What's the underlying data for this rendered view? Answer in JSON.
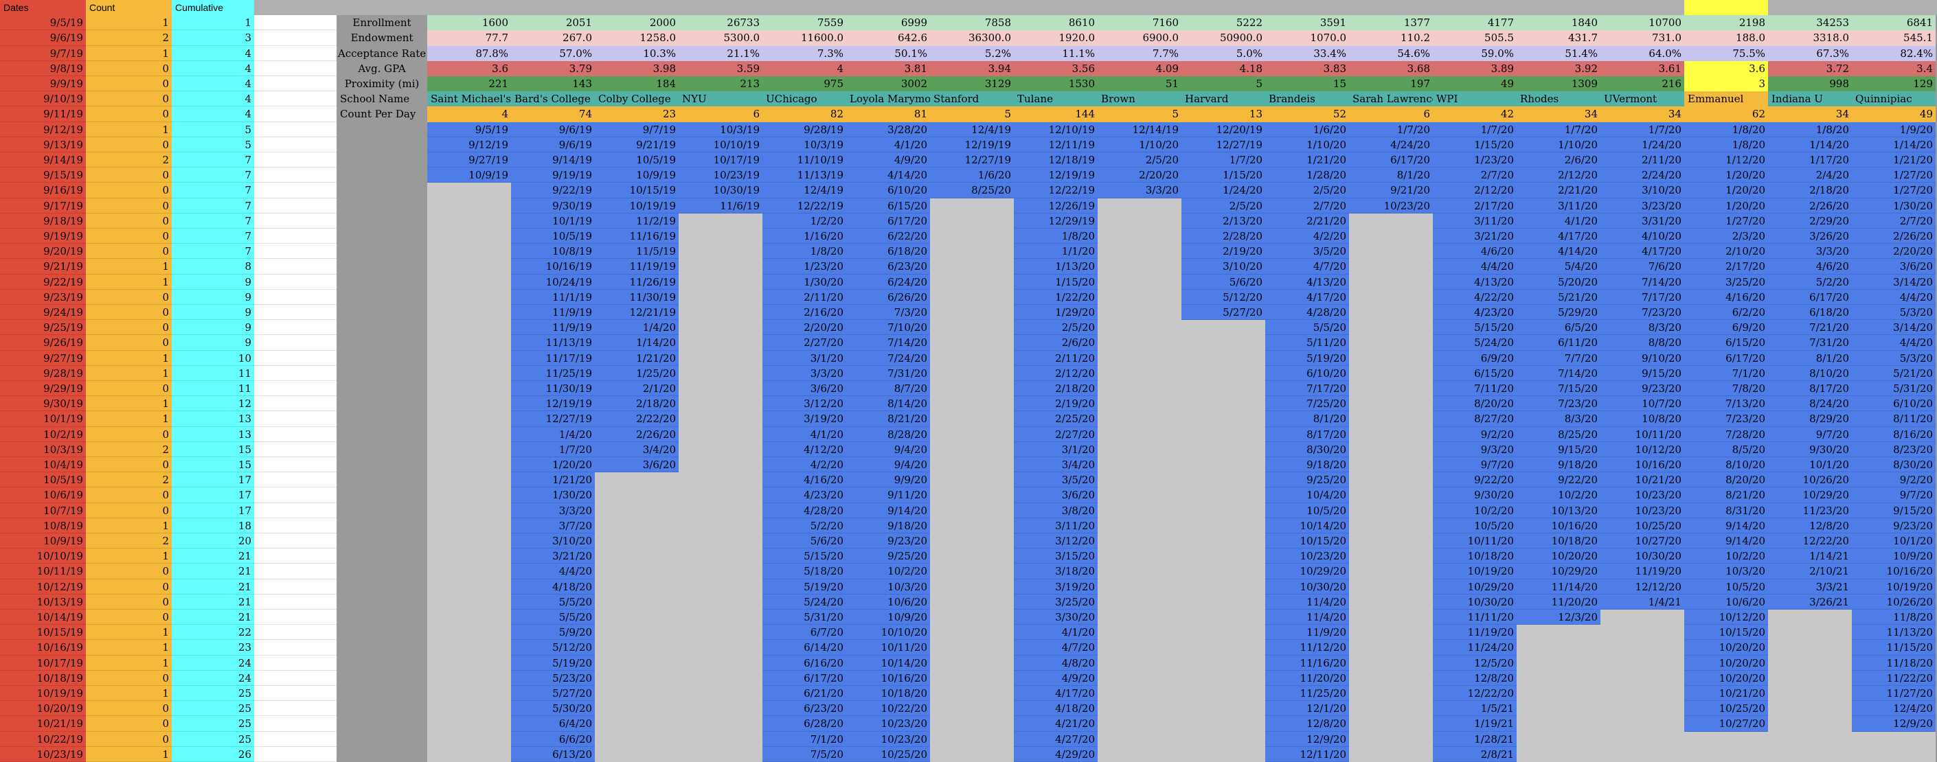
{
  "colors": {
    "dates": "#dd4b3a",
    "count": "#f5b93b",
    "cumulative": "#66ffff",
    "white": "#ffffff",
    "gray": "#9a9a9a",
    "lightgray": "#c8c8c8",
    "blue": "#4f7de8",
    "enroll": "#b7e1c1",
    "endow": "#f4cccc",
    "accept": "#c6c5f0",
    "gpa": "#d76f6f",
    "prox": "#5aa05a",
    "name": "#52b2a8",
    "countday": "#f5b93b",
    "yellow": "#ffff44",
    "topbar": "#b0b0b0"
  },
  "headers": {
    "dates": "Dates",
    "count": "Count",
    "cumulative": "Cumulative"
  },
  "left": {
    "dates": [
      "9/5/19",
      "9/6/19",
      "9/7/19",
      "9/8/19",
      "9/9/19",
      "9/10/19",
      "9/11/19",
      "9/12/19",
      "9/13/19",
      "9/14/19",
      "9/15/19",
      "9/16/19",
      "9/17/19",
      "9/18/19",
      "9/19/19",
      "9/20/19",
      "9/21/19",
      "9/22/19",
      "9/23/19",
      "9/24/19",
      "9/25/19",
      "9/26/19",
      "9/27/19",
      "9/28/19",
      "9/29/19",
      "9/30/19",
      "10/1/19",
      "10/2/19",
      "10/3/19",
      "10/4/19",
      "10/5/19",
      "10/6/19",
      "10/7/19",
      "10/8/19",
      "10/9/19",
      "10/10/19",
      "10/11/19",
      "10/12/19",
      "10/13/19",
      "10/14/19",
      "10/15/19",
      "10/16/19",
      "10/17/19",
      "10/18/19",
      "10/19/19",
      "10/20/19",
      "10/21/19",
      "10/22/19",
      "10/23/19"
    ],
    "counts": [
      "1",
      "2",
      "1",
      "0",
      "0",
      "0",
      "0",
      "1",
      "0",
      "2",
      "0",
      "0",
      "0",
      "0",
      "0",
      "0",
      "1",
      "1",
      "0",
      "0",
      "0",
      "0",
      "1",
      "1",
      "0",
      "1",
      "1",
      "0",
      "2",
      "0",
      "2",
      "0",
      "0",
      "1",
      "2",
      "1",
      "0",
      "0",
      "0",
      "0",
      "1",
      "1",
      "1",
      "0",
      "1",
      "0",
      "0",
      "0",
      "1"
    ],
    "cumulative": [
      "1",
      "3",
      "4",
      "4",
      "4",
      "4",
      "4",
      "5",
      "5",
      "7",
      "7",
      "7",
      "7",
      "7",
      "7",
      "7",
      "8",
      "9",
      "9",
      "9",
      "9",
      "9",
      "10",
      "11",
      "11",
      "12",
      "13",
      "13",
      "15",
      "15",
      "17",
      "17",
      "17",
      "18",
      "20",
      "21",
      "21",
      "21",
      "21",
      "21",
      "22",
      "23",
      "24",
      "24",
      "25",
      "25",
      "25",
      "25",
      "26"
    ]
  },
  "row_labels": [
    "Enrollment",
    "Endowment",
    "Acceptance Rate",
    "Avg. GPA",
    "Proximity (mi)",
    "School Name",
    "Count Per Day"
  ],
  "schools": [
    {
      "name": "Saint Michael's",
      "enrollment": "1600",
      "endowment": "77.7",
      "acceptance": "87.8%",
      "gpa": "3.6",
      "proximity": "221",
      "count": "4",
      "dates": [
        "9/5/19",
        "9/12/19",
        "9/27/19",
        "10/9/19"
      ]
    },
    {
      "name": "Bard's College",
      "enrollment": "2051",
      "endowment": "267.0",
      "acceptance": "57.0%",
      "gpa": "3.79",
      "proximity": "143",
      "count": "74",
      "dates": [
        "9/6/19",
        "9/6/19",
        "9/14/19",
        "9/19/19",
        "9/22/19",
        "9/30/19",
        "10/1/19",
        "10/5/19",
        "10/8/19",
        "10/16/19",
        "10/24/19",
        "11/1/19",
        "11/9/19",
        "11/9/19",
        "11/13/19",
        "11/17/19",
        "11/25/19",
        "11/30/19",
        "12/19/19",
        "12/27/19",
        "1/4/20",
        "1/7/20",
        "1/20/20",
        "1/21/20",
        "1/30/20",
        "3/3/20",
        "3/7/20",
        "3/10/20",
        "3/21/20",
        "4/4/20",
        "4/18/20",
        "5/5/20",
        "5/5/20",
        "5/9/20",
        "5/12/20",
        "5/19/20",
        "5/23/20",
        "5/27/20",
        "5/30/20",
        "6/4/20",
        "6/6/20",
        "6/13/20"
      ]
    },
    {
      "name": "Colby College",
      "enrollment": "2000",
      "endowment": "1258.0",
      "acceptance": "10.3%",
      "gpa": "3.98",
      "proximity": "184",
      "count": "23",
      "dates": [
        "9/7/19",
        "9/21/19",
        "10/5/19",
        "10/9/19",
        "10/15/19",
        "10/19/19",
        "11/2/19",
        "11/16/19",
        "11/5/19",
        "11/19/19",
        "11/26/19",
        "11/30/19",
        "12/21/19",
        "1/4/20",
        "1/14/20",
        "1/21/20",
        "1/25/20",
        "2/1/20",
        "2/18/20",
        "2/22/20",
        "2/26/20",
        "3/4/20",
        "3/6/20"
      ]
    },
    {
      "name": "NYU",
      "enrollment": "26733",
      "endowment": "5300.0",
      "acceptance": "21.1%",
      "gpa": "3.59",
      "proximity": "213",
      "count": "6",
      "dates": [
        "10/3/19",
        "10/10/19",
        "10/17/19",
        "10/23/19",
        "10/30/19",
        "11/6/19"
      ]
    },
    {
      "name": "UChicago",
      "enrollment": "7559",
      "endowment": "11600.0",
      "acceptance": "7.3%",
      "gpa": "4",
      "proximity": "975",
      "count": "82",
      "dates": [
        "9/28/19",
        "10/3/19",
        "11/10/19",
        "11/13/19",
        "12/4/19",
        "12/22/19",
        "1/2/20",
        "1/16/20",
        "1/8/20",
        "1/23/20",
        "1/30/20",
        "2/11/20",
        "2/16/20",
        "2/20/20",
        "2/27/20",
        "3/1/20",
        "3/3/20",
        "3/6/20",
        "3/12/20",
        "3/19/20",
        "4/1/20",
        "4/12/20",
        "4/2/20",
        "4/16/20",
        "4/23/20",
        "4/28/20",
        "5/2/20",
        "5/6/20",
        "5/15/20",
        "5/18/20",
        "5/19/20",
        "5/24/20",
        "5/31/20",
        "6/7/20",
        "6/14/20",
        "6/16/20",
        "6/17/20",
        "6/21/20",
        "6/23/20",
        "6/28/20",
        "7/1/20",
        "7/5/20"
      ]
    },
    {
      "name": "Loyola Marymount",
      "enrollment": "6999",
      "endowment": "642.6",
      "acceptance": "50.1%",
      "gpa": "3.81",
      "proximity": "3002",
      "count": "81",
      "dates": [
        "3/28/20",
        "4/1/20",
        "4/9/20",
        "4/14/20",
        "6/10/20",
        "6/15/20",
        "6/17/20",
        "6/22/20",
        "6/18/20",
        "6/23/20",
        "6/24/20",
        "6/26/20",
        "7/3/20",
        "7/10/20",
        "7/14/20",
        "7/24/20",
        "7/31/20",
        "8/7/20",
        "8/14/20",
        "8/21/20",
        "8/28/20",
        "9/4/20",
        "9/4/20",
        "9/9/20",
        "9/11/20",
        "9/14/20",
        "9/18/20",
        "9/23/20",
        "9/25/20",
        "10/2/20",
        "10/3/20",
        "10/6/20",
        "10/9/20",
        "10/10/20",
        "10/11/20",
        "10/14/20",
        "10/16/20",
        "10/18/20",
        "10/22/20",
        "10/23/20",
        "10/23/20",
        "10/25/20"
      ]
    },
    {
      "name": "Stanford",
      "enrollment": "7858",
      "endowment": "36300.0",
      "acceptance": "5.2%",
      "gpa": "3.94",
      "proximity": "3129",
      "count": "5",
      "dates": [
        "12/4/19",
        "12/19/19",
        "12/27/19",
        "1/6/20",
        "8/25/20"
      ]
    },
    {
      "name": "Tulane",
      "enrollment": "8610",
      "endowment": "1920.0",
      "acceptance": "11.1%",
      "gpa": "3.56",
      "proximity": "1530",
      "count": "144",
      "dates": [
        "12/10/19",
        "12/11/19",
        "12/18/19",
        "12/19/19",
        "12/22/19",
        "12/26/19",
        "12/29/19",
        "1/8/20",
        "1/1/20",
        "1/13/20",
        "1/15/20",
        "1/22/20",
        "1/29/20",
        "2/5/20",
        "2/6/20",
        "2/11/20",
        "2/12/20",
        "2/18/20",
        "2/19/20",
        "2/25/20",
        "2/27/20",
        "3/1/20",
        "3/4/20",
        "3/5/20",
        "3/6/20",
        "3/8/20",
        "3/11/20",
        "3/12/20",
        "3/15/20",
        "3/18/20",
        "3/19/20",
        "3/25/20",
        "3/30/20",
        "4/1/20",
        "4/7/20",
        "4/8/20",
        "4/9/20",
        "4/17/20",
        "4/18/20",
        "4/21/20",
        "4/27/20",
        "4/29/20"
      ]
    },
    {
      "name": "Brown",
      "enrollment": "7160",
      "endowment": "6900.0",
      "acceptance": "7.7%",
      "gpa": "4.09",
      "proximity": "51",
      "count": "5",
      "dates": [
        "12/14/19",
        "1/10/20",
        "2/5/20",
        "2/20/20",
        "3/3/20"
      ]
    },
    {
      "name": "Harvard",
      "enrollment": "5222",
      "endowment": "50900.0",
      "acceptance": "5.0%",
      "gpa": "4.18",
      "proximity": "5",
      "count": "13",
      "dates": [
        "12/20/19",
        "12/27/19",
        "1/7/20",
        "1/15/20",
        "1/24/20",
        "2/5/20",
        "2/13/20",
        "2/28/20",
        "2/19/20",
        "3/10/20",
        "5/6/20",
        "5/12/20",
        "5/27/20"
      ]
    },
    {
      "name": "Brandeis",
      "enrollment": "3591",
      "endowment": "1070.0",
      "acceptance": "33.4%",
      "gpa": "3.83",
      "proximity": "15",
      "count": "52",
      "dates": [
        "1/6/20",
        "1/10/20",
        "1/21/20",
        "1/28/20",
        "2/5/20",
        "2/7/20",
        "2/21/20",
        "4/2/20",
        "3/5/20",
        "4/7/20",
        "4/13/20",
        "4/17/20",
        "4/28/20",
        "5/5/20",
        "5/11/20",
        "5/19/20",
        "6/10/20",
        "7/17/20",
        "7/25/20",
        "8/1/20",
        "8/17/20",
        "8/30/20",
        "9/18/20",
        "9/25/20",
        "10/4/20",
        "10/5/20",
        "10/14/20",
        "10/15/20",
        "10/23/20",
        "10/29/20",
        "10/30/20",
        "11/4/20",
        "11/4/20",
        "11/9/20",
        "11/12/20",
        "11/16/20",
        "11/20/20",
        "11/25/20",
        "12/1/20",
        "12/8/20",
        "12/9/20",
        "12/11/20"
      ]
    },
    {
      "name": "Sarah Lawrence",
      "enrollment": "1377",
      "endowment": "110.2",
      "acceptance": "54.6%",
      "gpa": "3.68",
      "proximity": "197",
      "count": "6",
      "dates": [
        "1/7/20",
        "4/24/20",
        "6/17/20",
        "8/1/20",
        "9/21/20",
        "10/23/20"
      ]
    },
    {
      "name": "WPI",
      "enrollment": "4177",
      "endowment": "505.5",
      "acceptance": "59.0%",
      "gpa": "3.89",
      "proximity": "49",
      "count": "42",
      "dates": [
        "1/7/20",
        "1/15/20",
        "1/23/20",
        "2/7/20",
        "2/12/20",
        "2/17/20",
        "3/11/20",
        "3/21/20",
        "4/6/20",
        "4/4/20",
        "4/13/20",
        "4/22/20",
        "4/23/20",
        "5/15/20",
        "5/24/20",
        "6/9/20",
        "6/15/20",
        "7/11/20",
        "8/20/20",
        "8/27/20",
        "9/2/20",
        "9/3/20",
        "9/7/20",
        "9/22/20",
        "9/30/20",
        "10/2/20",
        "10/5/20",
        "10/11/20",
        "10/18/20",
        "10/19/20",
        "10/29/20",
        "10/30/20",
        "11/11/20",
        "11/19/20",
        "11/24/20",
        "12/5/20",
        "12/8/20",
        "12/22/20",
        "1/5/21",
        "1/19/21",
        "1/28/21",
        "2/8/21",
        "2/13/21"
      ]
    },
    {
      "name": "Rhodes",
      "enrollment": "1840",
      "endowment": "431.7",
      "acceptance": "51.4%",
      "gpa": "3.92",
      "proximity": "1309",
      "count": "34",
      "dates": [
        "1/7/20",
        "1/10/20",
        "2/6/20",
        "2/12/20",
        "2/21/20",
        "3/11/20",
        "4/1/20",
        "4/17/20",
        "4/14/20",
        "5/4/20",
        "5/20/20",
        "5/21/20",
        "5/29/20",
        "6/5/20",
        "6/11/20",
        "7/7/20",
        "7/14/20",
        "7/15/20",
        "7/23/20",
        "8/3/20",
        "8/25/20",
        "9/15/20",
        "9/18/20",
        "9/22/20",
        "10/2/20",
        "10/13/20",
        "10/16/20",
        "10/18/20",
        "10/20/20",
        "10/29/20",
        "11/14/20",
        "11/20/20",
        "12/3/20"
      ]
    },
    {
      "name": "UVermont",
      "enrollment": "10700",
      "endowment": "731.0",
      "acceptance": "64.0%",
      "gpa": "3.61",
      "proximity": "216",
      "count": "34",
      "dates": [
        "1/7/20",
        "1/24/20",
        "2/11/20",
        "2/24/20",
        "3/10/20",
        "3/23/20",
        "3/31/20",
        "4/10/20",
        "4/17/20",
        "7/6/20",
        "7/14/20",
        "7/17/20",
        "7/23/20",
        "8/3/20",
        "8/8/20",
        "9/10/20",
        "9/15/20",
        "9/23/20",
        "10/7/20",
        "10/8/20",
        "10/11/20",
        "10/12/20",
        "10/16/20",
        "10/21/20",
        "10/23/20",
        "10/23/20",
        "10/25/20",
        "10/27/20",
        "10/30/20",
        "11/19/20",
        "12/12/20",
        "1/4/21"
      ]
    },
    {
      "name": "Emmanuel",
      "enrollment": "2198",
      "endowment": "188.0",
      "acceptance": "75.5%",
      "gpa": "3.6",
      "proximity": "3",
      "count": "62",
      "highlight": true,
      "dates": [
        "1/8/20",
        "1/8/20",
        "1/12/20",
        "1/20/20",
        "1/20/20",
        "1/20/20",
        "1/27/20",
        "2/3/20",
        "2/10/20",
        "2/17/20",
        "3/25/20",
        "4/16/20",
        "6/2/20",
        "6/9/20",
        "6/15/20",
        "6/17/20",
        "7/1/20",
        "7/8/20",
        "7/13/20",
        "7/23/20",
        "7/28/20",
        "8/5/20",
        "8/10/20",
        "8/20/20",
        "8/21/20",
        "8/31/20",
        "9/14/20",
        "9/14/20",
        "10/2/20",
        "10/3/20",
        "10/5/20",
        "10/6/20",
        "10/12/20",
        "10/15/20",
        "10/20/20",
        "10/20/20",
        "10/20/20",
        "10/21/20",
        "10/25/20",
        "10/27/20"
      ]
    },
    {
      "name": "Indiana U",
      "enrollment": "34253",
      "endowment": "3318.0",
      "acceptance": "67.3%",
      "gpa": "3.72",
      "proximity": "998",
      "count": "34",
      "dates": [
        "1/8/20",
        "1/14/20",
        "1/17/20",
        "2/4/20",
        "2/18/20",
        "2/26/20",
        "2/29/20",
        "3/26/20",
        "3/3/20",
        "4/6/20",
        "5/2/20",
        "6/17/20",
        "6/18/20",
        "7/21/20",
        "7/31/20",
        "8/1/20",
        "8/10/20",
        "8/17/20",
        "8/24/20",
        "8/29/20",
        "9/7/20",
        "9/30/20",
        "10/1/20",
        "10/26/20",
        "10/29/20",
        "11/23/20",
        "12/8/20",
        "12/22/20",
        "1/14/21",
        "2/10/21",
        "3/3/21",
        "3/26/21"
      ]
    },
    {
      "name": "Quinnipiac",
      "enrollment": "6841",
      "endowment": "545.1",
      "acceptance": "82.4%",
      "gpa": "3.4",
      "proximity": "129",
      "count": "49",
      "dates": [
        "1/9/20",
        "1/14/20",
        "1/21/20",
        "1/27/20",
        "1/27/20",
        "1/30/20",
        "2/7/20",
        "2/26/20",
        "2/20/20",
        "3/6/20",
        "3/14/20",
        "4/4/20",
        "5/3/20",
        "3/14/20",
        "4/4/20",
        "5/3/20",
        "5/21/20",
        "5/31/20",
        "6/10/20",
        "8/11/20",
        "8/16/20",
        "8/23/20",
        "8/30/20",
        "9/2/20",
        "9/7/20",
        "9/15/20",
        "9/23/20",
        "10/1/20",
        "10/9/20",
        "10/16/20",
        "10/19/20",
        "10/26/20",
        "11/8/20",
        "11/13/20",
        "11/15/20",
        "11/18/20",
        "11/22/20",
        "11/27/20",
        "12/4/20",
        "12/9/20"
      ]
    }
  ]
}
